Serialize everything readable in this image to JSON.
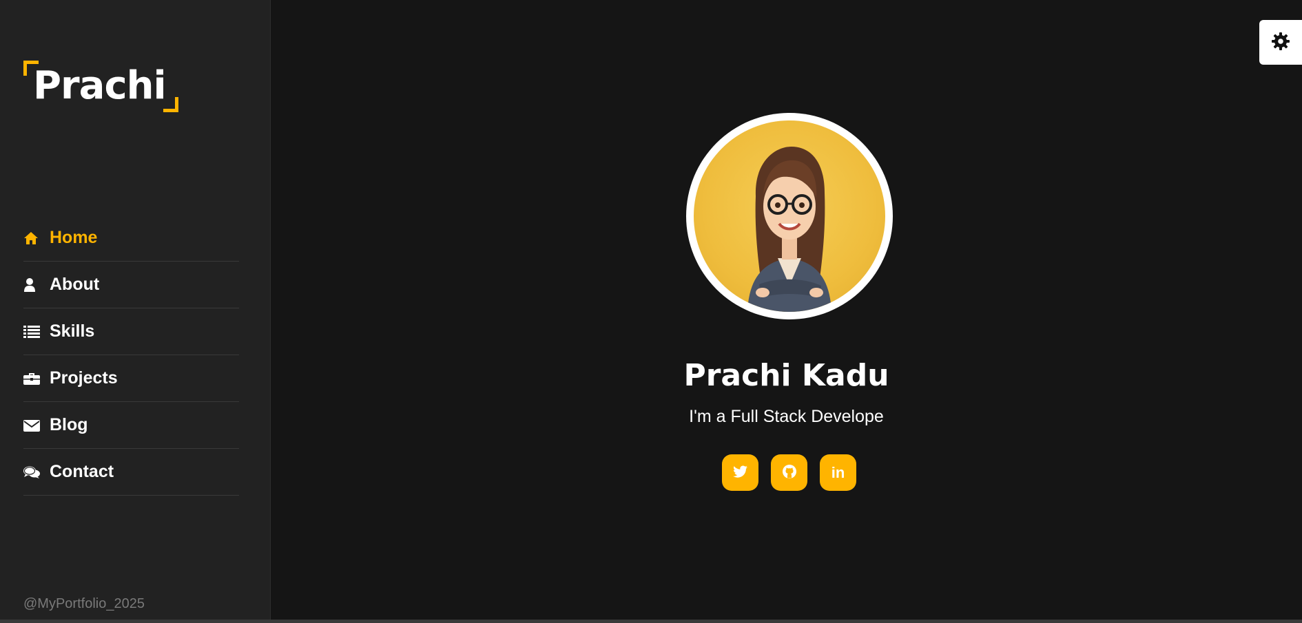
{
  "sidebar": {
    "logo_text": "Prachi",
    "nav": [
      {
        "label": "Home",
        "icon": "home-icon",
        "active": true
      },
      {
        "label": "About",
        "icon": "user-icon",
        "active": false
      },
      {
        "label": "Skills",
        "icon": "list-icon",
        "active": false
      },
      {
        "label": "Projects",
        "icon": "briefcase-icon",
        "active": false
      },
      {
        "label": "Blog",
        "icon": "envelope-icon",
        "active": false
      },
      {
        "label": "Contact",
        "icon": "comments-icon",
        "active": false
      }
    ],
    "footer": "@MyPortfolio_2025"
  },
  "hero": {
    "name": "Prachi Kadu",
    "tagline": "I'm a Full Stack Develope",
    "avatar": "avatar-portrait",
    "socials": [
      {
        "name": "twitter-icon"
      },
      {
        "name": "github-icon"
      },
      {
        "name": "linkedin-icon",
        "label": "in"
      }
    ]
  },
  "settings": {
    "icon": "gear-icon"
  },
  "colors": {
    "accent": "#ffb400",
    "background": "#151515",
    "sidebar": "#222222",
    "text": "#ffffff",
    "muted": "#7a7a7a"
  }
}
